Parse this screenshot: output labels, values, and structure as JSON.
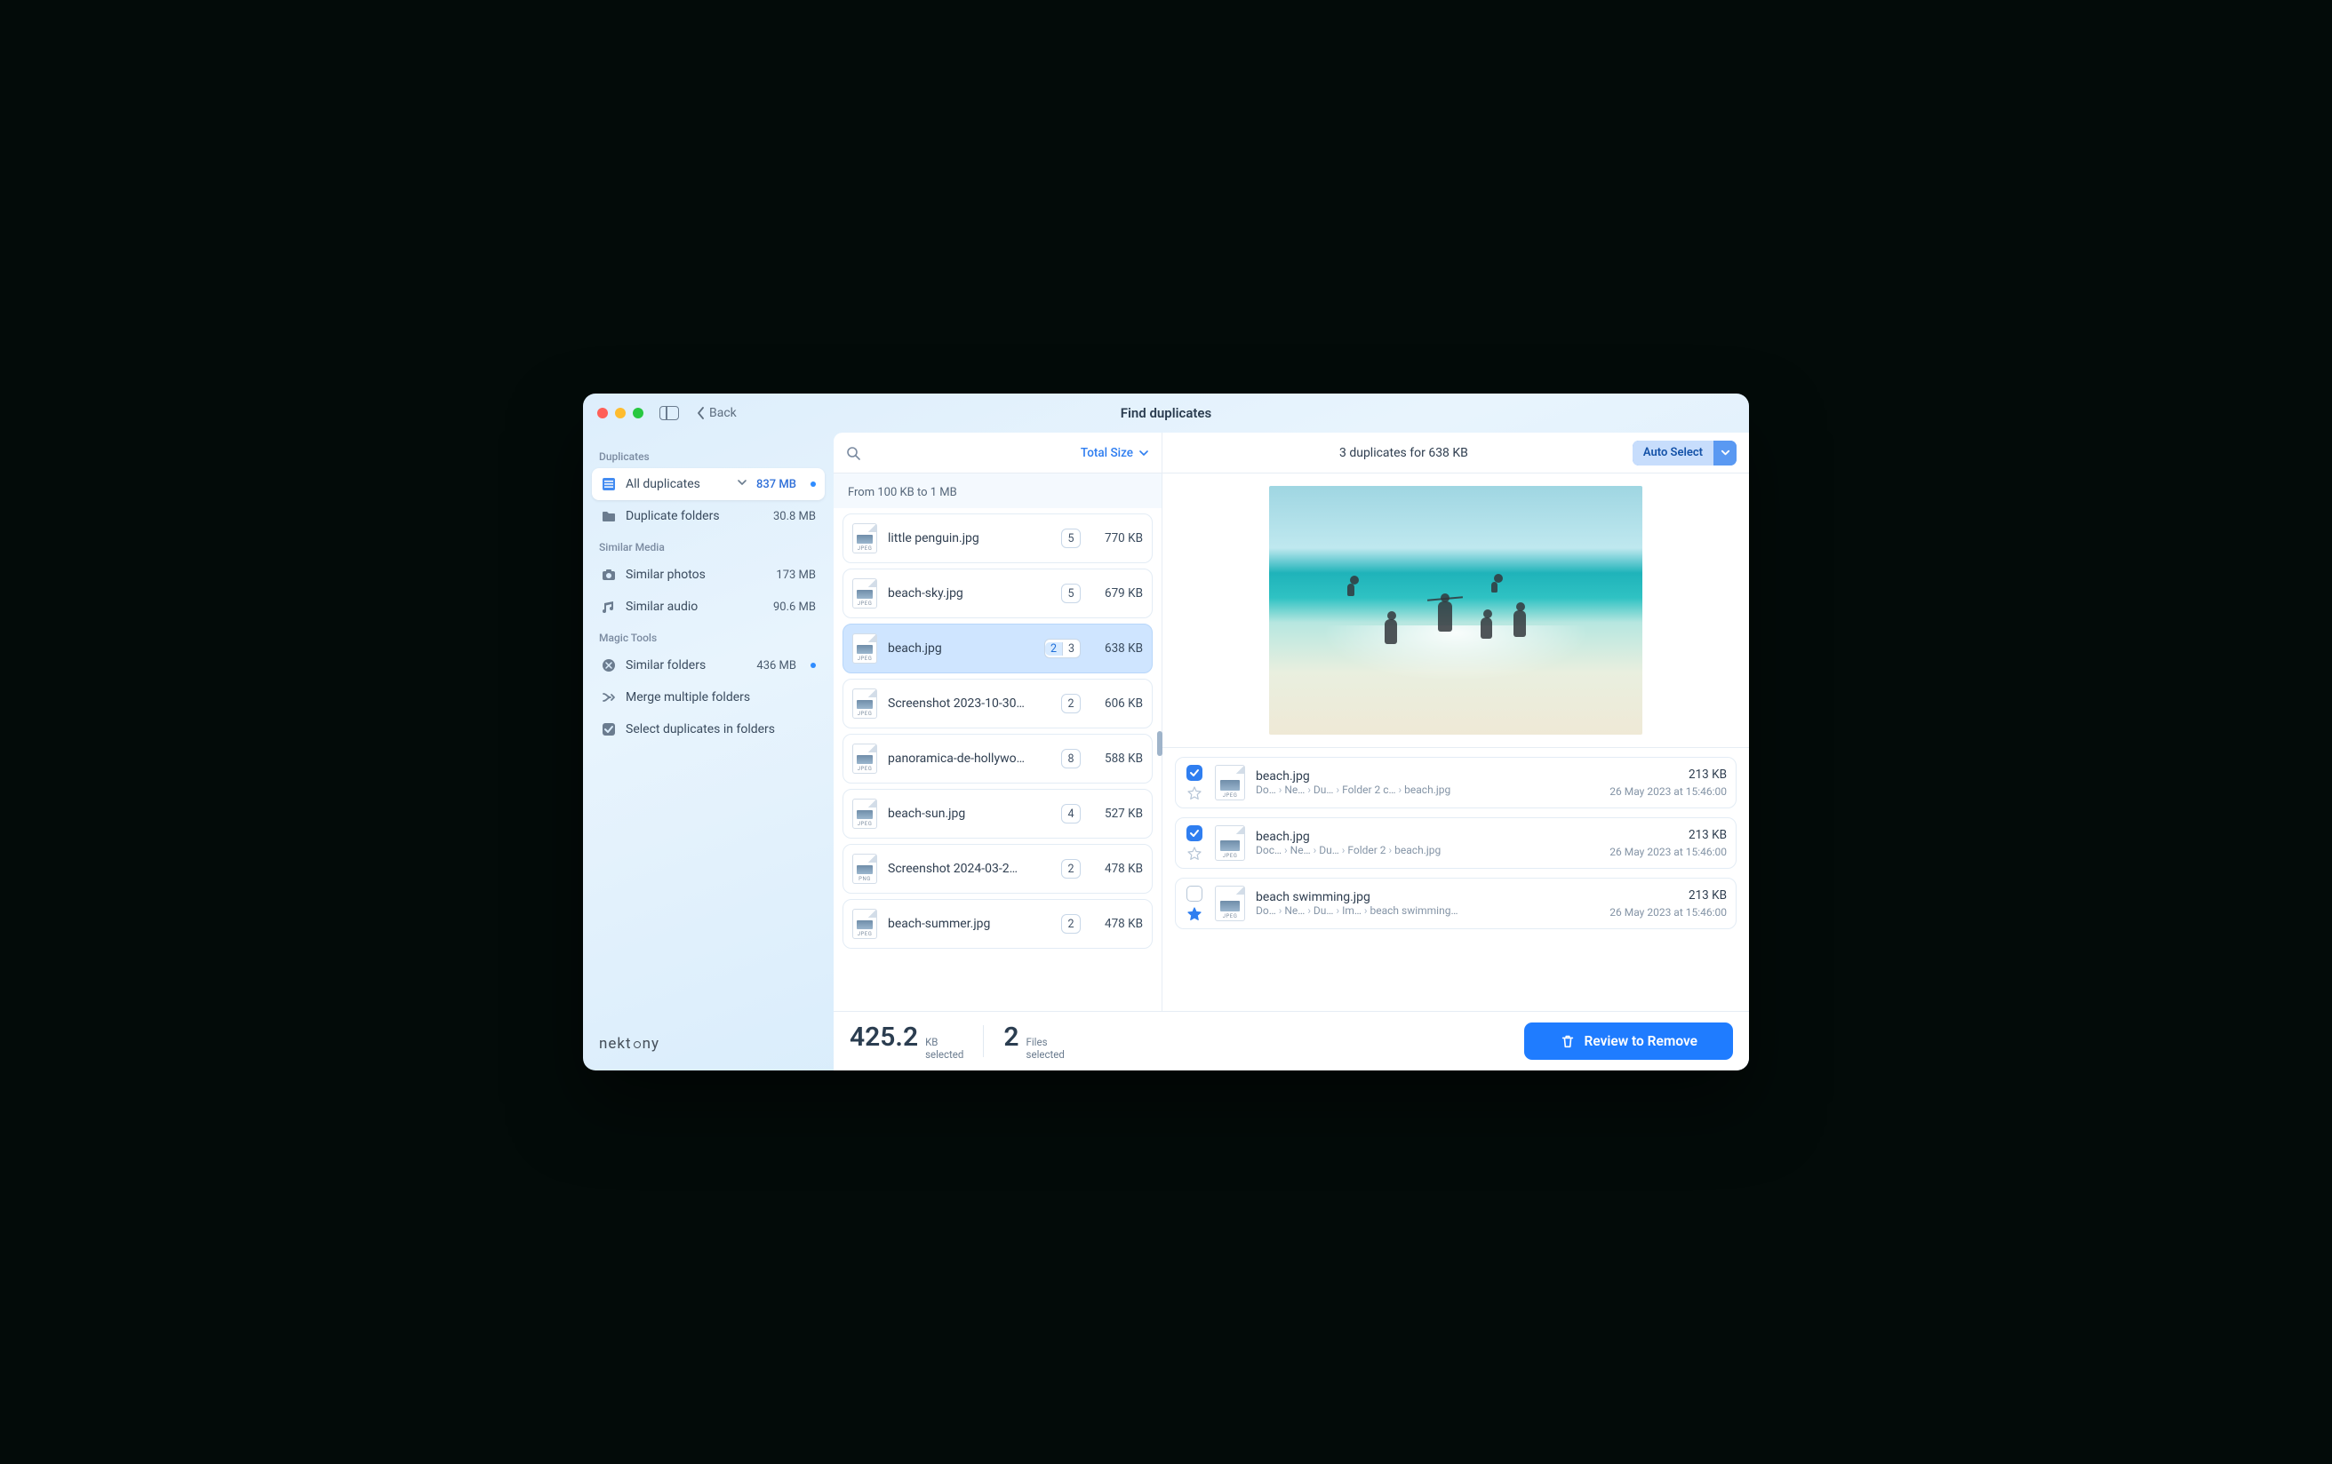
{
  "window_title": "Find duplicates",
  "back_label": "Back",
  "brand": "nektony",
  "sidebar": {
    "sections": [
      {
        "label": "Duplicates",
        "items": [
          {
            "id": "all-duplicates",
            "label": "All duplicates",
            "value": "837 MB",
            "icon": "list-icon",
            "active": true,
            "chevron": true,
            "dot": true
          },
          {
            "id": "duplicate-folders",
            "label": "Duplicate folders",
            "value": "30.8 MB",
            "icon": "folder-icon"
          }
        ]
      },
      {
        "label": "Similar Media",
        "items": [
          {
            "id": "similar-photos",
            "label": "Similar photos",
            "value": "173 MB",
            "icon": "camera-icon"
          },
          {
            "id": "similar-audio",
            "label": "Similar audio",
            "value": "90.6 MB",
            "icon": "music-icon"
          }
        ]
      },
      {
        "label": "Magic Tools",
        "items": [
          {
            "id": "similar-folders",
            "label": "Similar folders",
            "value": "436 MB",
            "icon": "compare-icon",
            "dot": true
          },
          {
            "id": "merge-folders",
            "label": "Merge multiple folders",
            "value": "",
            "icon": "merge-icon"
          },
          {
            "id": "select-dups",
            "label": "Select duplicates in folders",
            "value": "",
            "icon": "check-icon"
          }
        ]
      }
    ]
  },
  "list": {
    "sort_label": "Total Size",
    "group_label": "From 100 KB to 1 MB",
    "items": [
      {
        "name": "little penguin.jpg",
        "ext": "JPEG",
        "count": "5",
        "size": "770 KB"
      },
      {
        "name": "beach-sky.jpg",
        "ext": "JPEG",
        "count": "5",
        "size": "679 KB"
      },
      {
        "name": "beach.jpg",
        "ext": "JPEG",
        "count_sel": "2",
        "count_tot": "3",
        "size": "638 KB",
        "selected": true
      },
      {
        "name": "Screenshot 2023-10-30…",
        "ext": "JPEG",
        "count": "2",
        "size": "606 KB"
      },
      {
        "name": "panoramica-de-hollywo…",
        "ext": "JPEG",
        "count": "8",
        "size": "588 KB"
      },
      {
        "name": "beach-sun.jpg",
        "ext": "JPEG",
        "count": "4",
        "size": "527 KB"
      },
      {
        "name": "Screenshot 2024-03-2…",
        "ext": "PNG",
        "count": "2",
        "size": "478 KB"
      },
      {
        "name": "beach-summer.jpg",
        "ext": "JPEG",
        "count": "2",
        "size": "478 KB"
      }
    ]
  },
  "detail": {
    "summary": "3 duplicates for 638 KB",
    "auto_select_label": "Auto Select",
    "duplicates": [
      {
        "checked": true,
        "starred": false,
        "name": "beach.jpg",
        "ext": "JPEG",
        "size": "213 KB",
        "date": "26 May 2023 at 15:46:00",
        "path": [
          "Do…",
          "Ne…",
          "Du…",
          "Folder 2 c…",
          "beach.jpg"
        ]
      },
      {
        "checked": true,
        "starred": false,
        "name": "beach.jpg",
        "ext": "JPEG",
        "size": "213 KB",
        "date": "26 May 2023 at 15:46:00",
        "path": [
          "Doc…",
          "Ne…",
          "Du…",
          "Folder 2",
          "beach.jpg"
        ]
      },
      {
        "checked": false,
        "starred": true,
        "name": "beach swimming.jpg",
        "ext": "JPEG",
        "size": "213 KB",
        "date": "26 May 2023 at 15:46:00",
        "path": [
          "Do…",
          "Ne…",
          "Du…",
          "Im…",
          "beach swimming…"
        ]
      }
    ]
  },
  "footer": {
    "size_value": "425.2",
    "size_unit": "KB",
    "size_label": "selected",
    "files_value": "2",
    "files_unit": "Files",
    "files_label": "selected",
    "review_label": "Review to Remove"
  }
}
